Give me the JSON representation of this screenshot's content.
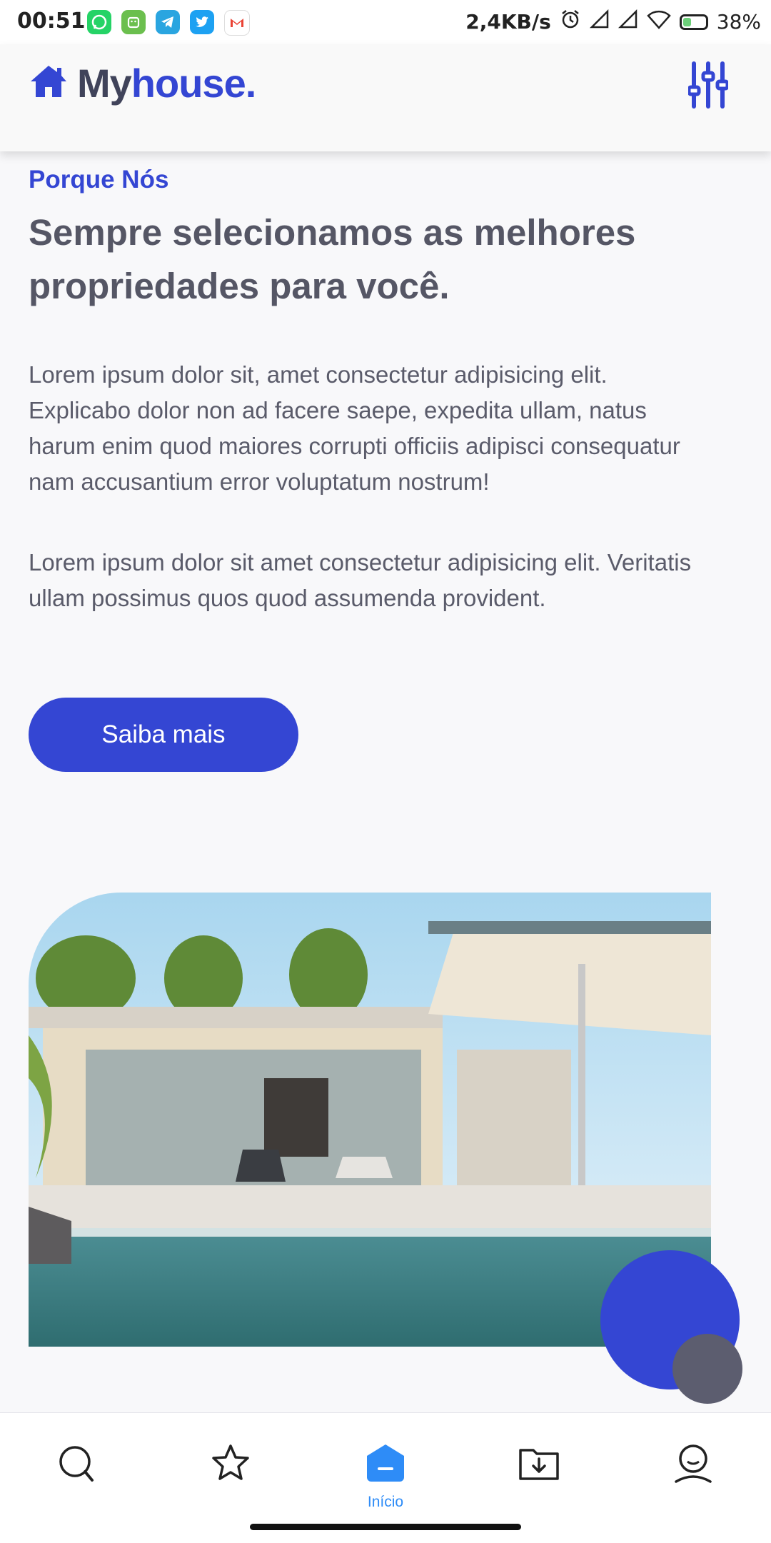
{
  "status_bar": {
    "time": "00:51",
    "speed": "2,4KB/s",
    "battery": "38%",
    "battery_level": 0.38,
    "app_icons": [
      "whatsapp-icon",
      "android-icon",
      "telegram-icon",
      "twitter-icon",
      "gmail-icon"
    ],
    "system_icons": [
      "alarm-icon",
      "signal-icon",
      "signal-icon",
      "wifi-icon",
      "battery-icon"
    ]
  },
  "header": {
    "logo_icon": "home-icon",
    "logo_my": "My",
    "logo_house": "house",
    "logo_dot": ".",
    "filter_icon": "sliders-icon"
  },
  "content": {
    "section_label": "Porque Nós",
    "heading": "Sempre selecionamos as melhores propriedades para você.",
    "paragraph1": "Lorem ipsum dolor sit, amet consectetur adipisicing elit. Explicabo dolor non ad facere saepe, expedita ullam, natus harum enim quod maiores corrupti officiis adipisci consequatur nam accusantium error voluptatum nostrum!",
    "paragraph2": "Lorem ipsum dolor sit amet consectetur adipisicing elit. Veritatis ullam possimus quos quod assumenda provident.",
    "cta_label": "Saiba mais"
  },
  "bottom_nav": {
    "items": [
      {
        "icon": "search-icon",
        "label": ""
      },
      {
        "icon": "star-icon",
        "label": ""
      },
      {
        "icon": "home-icon",
        "label": "Início",
        "active": true
      },
      {
        "icon": "download-folder-icon",
        "label": ""
      },
      {
        "icon": "user-icon",
        "label": ""
      }
    ]
  },
  "colors": {
    "brand": "#3446d3",
    "text": "#555665",
    "nav_active": "#2e8cf7"
  }
}
